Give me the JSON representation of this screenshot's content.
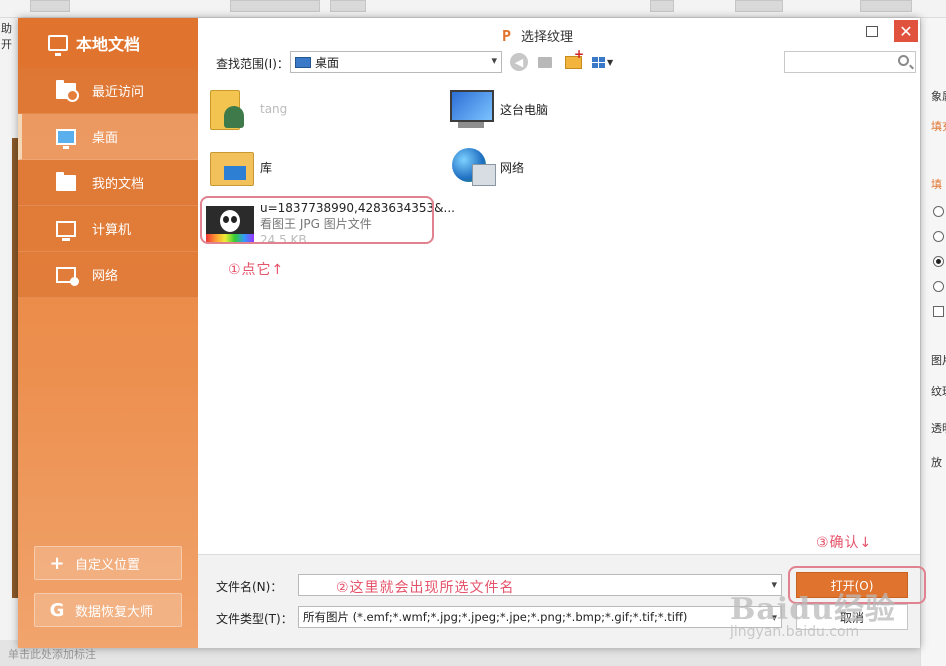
{
  "background": {
    "left_text": "助开",
    "right_texts": [
      "象属",
      "填充",
      "填",
      "图片",
      "纹理",
      "透明",
      "放"
    ],
    "status_text": "单击此处添加标注"
  },
  "sidebar": {
    "title": "本地文档",
    "items": [
      {
        "label": "最近访问",
        "icon": "recent-folder-icon"
      },
      {
        "label": "桌面",
        "icon": "desktop-icon",
        "active": true
      },
      {
        "label": "我的文档",
        "icon": "documents-folder-icon"
      },
      {
        "label": "计算机",
        "icon": "computer-icon"
      },
      {
        "label": "网络",
        "icon": "network-icon"
      }
    ],
    "custom_location": "自定义位置",
    "data_recovery": "数据恢复大师"
  },
  "dialog": {
    "title": "选择纹理",
    "look_in_label": "查找范围(I)：",
    "look_in_value": "桌面",
    "search_placeholder": "",
    "files": [
      {
        "name": "tang",
        "icon": "user-folder-icon"
      },
      {
        "name": "这台电脑",
        "icon": "this-pc-icon"
      },
      {
        "name": "库",
        "icon": "library-icon"
      },
      {
        "name": "网络",
        "icon": "network-globe-icon"
      },
      {
        "name": "u=1837738990,4283634353&...",
        "type": "看图王 JPG 图片文件",
        "size": "24.5 KB",
        "icon": "jpg-thumbnail"
      }
    ],
    "filename_label": "文件名(N)：",
    "filename_value": "",
    "filetype_label": "文件类型(T)：",
    "filetype_value": "所有图片 (*.emf;*.wmf;*.jpg;*.jpeg;*.jpe;*.png;*.bmp;*.gif;*.tif;*.tiff)",
    "open_button": "打开(O)",
    "cancel_button": "取消"
  },
  "annotations": {
    "step1": "①点它↑",
    "step2": "②这里就会出现所选文件名",
    "step3": "③确认↓"
  },
  "watermark": {
    "brand": "Baidu经验",
    "url": "jingyan.baidu.com"
  },
  "colors": {
    "accent": "#e0742f",
    "annotation": "#e5536a",
    "close": "#e0513e"
  }
}
